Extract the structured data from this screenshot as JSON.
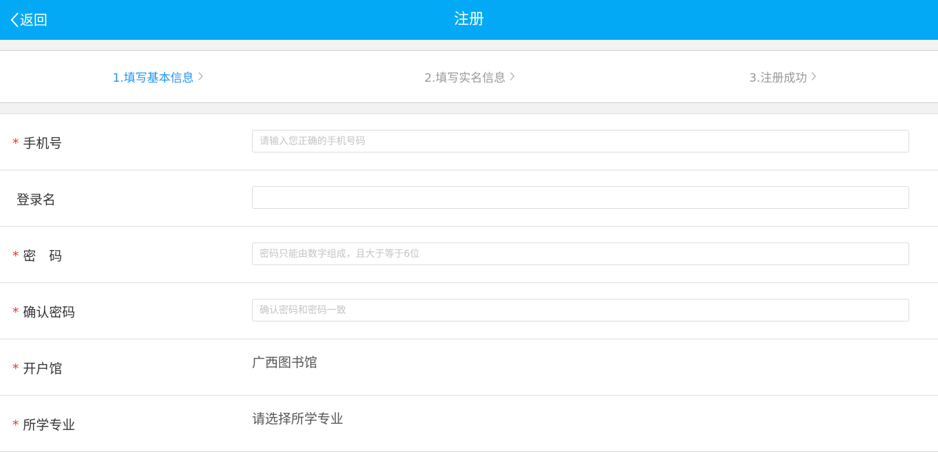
{
  "header": {
    "back_label": "返回",
    "title": "注册",
    "background_color": "#03a9f4"
  },
  "steps": [
    {
      "label": "1.填写基本信息",
      "active": true
    },
    {
      "label": "2.填写实名信息",
      "active": false
    },
    {
      "label": "3.注册成功",
      "active": false
    }
  ],
  "form": {
    "phone": {
      "label": "手机号",
      "required": true,
      "placeholder": "请输入您正确的手机号码",
      "value": ""
    },
    "login_name": {
      "label": "登录名",
      "required": false,
      "placeholder": "",
      "value": ""
    },
    "password": {
      "label": "密　码",
      "required": true,
      "placeholder": "密码只能由数字组成，且大于等于6位",
      "value": ""
    },
    "confirm_password": {
      "label": "确认密码",
      "required": true,
      "placeholder": "确认密码和密码一致",
      "value": ""
    },
    "library": {
      "label": "开户馆",
      "required": true,
      "value": "广西图书馆"
    },
    "major": {
      "label": "所学专业",
      "required": true,
      "value": "请选择所学专业"
    }
  },
  "required_mark": "*",
  "colors": {
    "accent": "#03a9f4",
    "active_step": "#2196f3",
    "required_star": "#e53935"
  }
}
